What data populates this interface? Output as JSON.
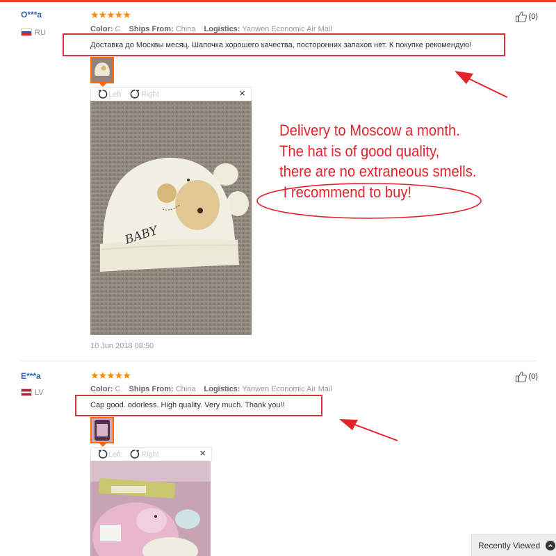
{
  "reviews": [
    {
      "user": "O***a",
      "country": "RU",
      "stars": "★★★★★",
      "color_label": "Color:",
      "color_value": "C",
      "ships_label": "Ships From:",
      "ships_value": "China",
      "logistics_label": "Logistics:",
      "logistics_value": "Yanwen Economic Air Mail",
      "text": "Доставка до Москвы месяц. Шапочка хорошего качества, посторонних запахов нет. К покупке рекомендую!",
      "helpful_count": "(0)",
      "rotate_left": "Left",
      "rotate_right": "Right",
      "close": "×",
      "date": "10 Jun 2018 08:50"
    },
    {
      "user": "E***a",
      "country": "LV",
      "stars": "★★★★★",
      "color_label": "Color:",
      "color_value": "C",
      "ships_label": "Ships From:",
      "ships_value": "China",
      "logistics_label": "Logistics:",
      "logistics_value": "Yanwen Economic Air Mail",
      "text": "Cap good. odorless. High quality. Very much. Thank you!!",
      "helpful_count": "(0)",
      "rotate_left": "Left",
      "rotate_right": "Right",
      "close": "×"
    }
  ],
  "annotation": {
    "line1": "Delivery to Moscow a month.",
    "line2": "The hat is of good quality,",
    "line3": "there are no extraneous smells.",
    "line4": " I recommend to buy!"
  },
  "photo_text": "BABY",
  "recently_viewed": "Recently Viewed",
  "colors": {
    "accent": "#ff6a00",
    "annotation_red": "#e4232c",
    "user_blue": "#2d5fbd",
    "star_orange": "#ff8a00"
  }
}
